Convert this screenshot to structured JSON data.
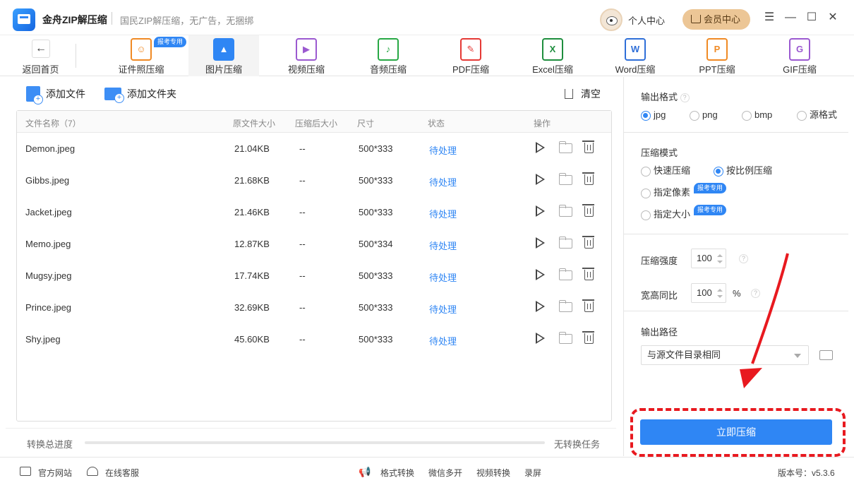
{
  "app": {
    "name": "金舟ZIP解压缩",
    "slogan": "国民ZIP解压缩，无广告，无捆绑"
  },
  "header": {
    "user_center": "个人中心",
    "vip_center": "会员中心"
  },
  "tabs": {
    "back": "返回首页",
    "badge": "报考专用",
    "items": [
      {
        "label": "证件照压缩",
        "icon": "id-photo-icon",
        "color": "#f08a24"
      },
      {
        "label": "图片压缩",
        "icon": "image-icon",
        "color": "#2f86f4"
      },
      {
        "label": "视频压缩",
        "icon": "video-icon",
        "color": "#9b59d0"
      },
      {
        "label": "音频压缩",
        "icon": "audio-icon",
        "color": "#27a844"
      },
      {
        "label": "PDF压缩",
        "icon": "pdf-icon",
        "color": "#e53935"
      },
      {
        "label": "Excel压缩",
        "icon": "excel-icon",
        "color": "#1e8e3e"
      },
      {
        "label": "Word压缩",
        "icon": "word-icon",
        "color": "#2f6fd8"
      },
      {
        "label": "PPT压缩",
        "icon": "ppt-icon",
        "color": "#f08a24"
      },
      {
        "label": "GIF压缩",
        "icon": "gif-icon",
        "color": "#9b59d0"
      }
    ]
  },
  "actions": {
    "add_file": "添加文件",
    "add_folder": "添加文件夹",
    "clear": "清空"
  },
  "table": {
    "headers": {
      "name": "文件名称（7）",
      "orig": "原文件大小",
      "after": "压缩后大小",
      "dims": "尺寸",
      "status": "状态",
      "ops": "操作"
    },
    "rows": [
      {
        "name": "Demon.jpeg",
        "size": "21.04KB",
        "after": "--",
        "dims": "500*333",
        "status": "待处理"
      },
      {
        "name": "Gibbs.jpeg",
        "size": "21.68KB",
        "after": "--",
        "dims": "500*333",
        "status": "待处理"
      },
      {
        "name": "Jacket.jpeg",
        "size": "21.46KB",
        "after": "--",
        "dims": "500*333",
        "status": "待处理"
      },
      {
        "name": "Memo.jpeg",
        "size": "12.87KB",
        "after": "--",
        "dims": "500*334",
        "status": "待处理"
      },
      {
        "name": "Mugsy.jpeg",
        "size": "17.74KB",
        "after": "--",
        "dims": "500*333",
        "status": "待处理"
      },
      {
        "name": "Prince.jpeg",
        "size": "32.69KB",
        "after": "--",
        "dims": "500*333",
        "status": "待处理"
      },
      {
        "name": "Shy.jpeg",
        "size": "45.60KB",
        "after": "--",
        "dims": "500*333",
        "status": "待处理"
      }
    ]
  },
  "progress": {
    "label": "转换总进度",
    "status": "无转换任务",
    "value": 0
  },
  "panel": {
    "format": {
      "title": "输出格式",
      "options": [
        "jpg",
        "png",
        "bmp",
        "源格式"
      ],
      "selected": "jpg"
    },
    "mode": {
      "title": "压缩模式",
      "fast": "快速压缩",
      "ratio": "按比例压缩",
      "pixel": "指定像素",
      "size": "指定大小",
      "badge": "报考专用",
      "selected": "按比例压缩"
    },
    "strength": {
      "label": "压缩强度",
      "value": "100"
    },
    "aspect": {
      "label": "宽高同比",
      "value": "100",
      "unit": "%"
    },
    "output": {
      "title": "输出路径",
      "value": "与源文件目录相同"
    },
    "start": "立即压缩"
  },
  "footer": {
    "website": "官方网站",
    "support": "在线客服",
    "format_convert": "格式转换",
    "wechat": "微信多开",
    "video_convert": "视频转换",
    "record": "录屏",
    "version": "版本号：v5.3.6"
  },
  "colors": {
    "accent": "#2f86f4",
    "highlight": "#e8191f",
    "vip": "#ecc696"
  }
}
